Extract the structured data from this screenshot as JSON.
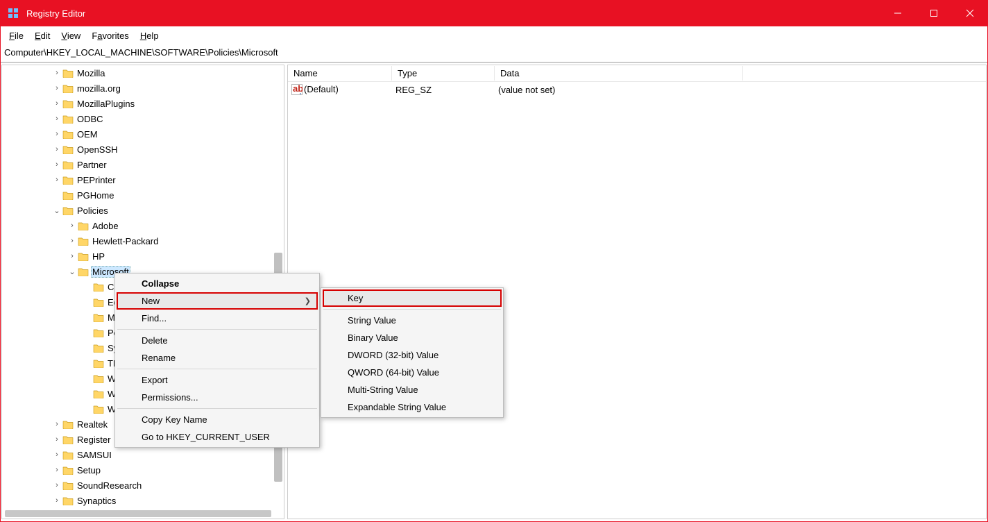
{
  "window": {
    "title": "Registry Editor"
  },
  "menu": {
    "file": "File",
    "edit": "Edit",
    "view": "View",
    "favorites": "Favorites",
    "help": "Help"
  },
  "address": {
    "path": "Computer\\HKEY_LOCAL_MACHINE\\SOFTWARE\\Policies\\Microsoft"
  },
  "tree": {
    "items": [
      {
        "depth": 0,
        "chev": "closed",
        "label": "Mozilla"
      },
      {
        "depth": 0,
        "chev": "closed",
        "label": "mozilla.org"
      },
      {
        "depth": 0,
        "chev": "closed",
        "label": "MozillaPlugins"
      },
      {
        "depth": 0,
        "chev": "closed",
        "label": "ODBC"
      },
      {
        "depth": 0,
        "chev": "closed",
        "label": "OEM"
      },
      {
        "depth": 0,
        "chev": "closed",
        "label": "OpenSSH"
      },
      {
        "depth": 0,
        "chev": "closed",
        "label": "Partner"
      },
      {
        "depth": 0,
        "chev": "closed",
        "label": "PEPrinter"
      },
      {
        "depth": 0,
        "chev": "none",
        "label": "PGHome"
      },
      {
        "depth": 0,
        "chev": "open",
        "label": "Policies"
      },
      {
        "depth": 1,
        "chev": "closed",
        "label": "Adobe"
      },
      {
        "depth": 1,
        "chev": "closed",
        "label": "Hewlett-Packard"
      },
      {
        "depth": 1,
        "chev": "closed",
        "label": "HP"
      },
      {
        "depth": 1,
        "chev": "open",
        "label": "Microsoft",
        "selected": true
      },
      {
        "depth": 2,
        "chev": "none",
        "label": "Cr"
      },
      {
        "depth": 2,
        "chev": "none",
        "label": "Ed"
      },
      {
        "depth": 2,
        "chev": "none",
        "label": "M"
      },
      {
        "depth": 2,
        "chev": "none",
        "label": "Pe"
      },
      {
        "depth": 2,
        "chev": "none",
        "label": "Sy"
      },
      {
        "depth": 2,
        "chev": "none",
        "label": "TF"
      },
      {
        "depth": 2,
        "chev": "none",
        "label": "W"
      },
      {
        "depth": 2,
        "chev": "none",
        "label": "W"
      },
      {
        "depth": 2,
        "chev": "none",
        "label": "W"
      },
      {
        "depth": 0,
        "chev": "closed",
        "label": "Realtek"
      },
      {
        "depth": 0,
        "chev": "closed",
        "label": "Register"
      },
      {
        "depth": 0,
        "chev": "closed",
        "label": "SAMSUI"
      },
      {
        "depth": 0,
        "chev": "closed",
        "label": "Setup"
      },
      {
        "depth": 0,
        "chev": "closed",
        "label": "SoundResearch"
      },
      {
        "depth": 0,
        "chev": "closed",
        "label": "Synaptics"
      }
    ]
  },
  "list": {
    "headers": {
      "name": "Name",
      "type": "Type",
      "data": "Data"
    },
    "rows": [
      {
        "name": "(Default)",
        "type": "REG_SZ",
        "data": "(value not set)"
      }
    ]
  },
  "ctx": {
    "collapse": "Collapse",
    "new": "New",
    "find": "Find...",
    "delete": "Delete",
    "rename": "Rename",
    "export": "Export",
    "permissions": "Permissions...",
    "copykey": "Copy Key Name",
    "goto": "Go to HKEY_CURRENT_USER"
  },
  "submenu": {
    "key": "Key",
    "string": "String Value",
    "binary": "Binary Value",
    "dword": "DWORD (32-bit) Value",
    "qword": "QWORD (64-bit) Value",
    "multistring": "Multi-String Value",
    "expandable": "Expandable String Value"
  }
}
